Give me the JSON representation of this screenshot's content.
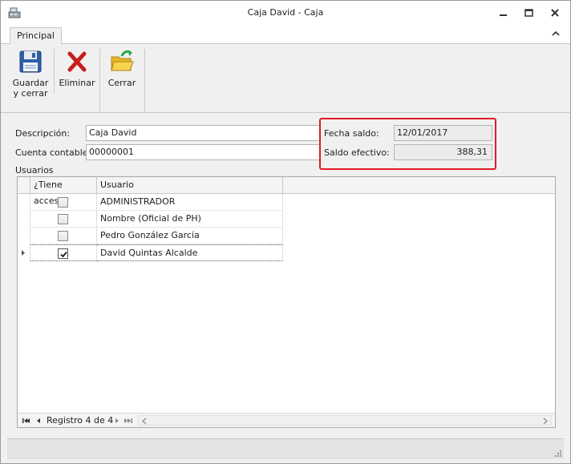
{
  "window": {
    "title": "Caja David - Caja",
    "icon": "cash-register-icon"
  },
  "ribbon": {
    "tab_principal": "Principal",
    "buttons": [
      {
        "id": "guardar",
        "label": "Guardar\ny cerrar",
        "icon": "floppy-disk-icon"
      },
      {
        "id": "eliminar",
        "label": "Eliminar",
        "icon": "red-x-icon"
      },
      {
        "id": "cerrar",
        "label": "Cerrar",
        "icon": "open-folder-icon"
      }
    ]
  },
  "form": {
    "descripcion_label": "Descripción:",
    "descripcion_value": "Caja David",
    "cuenta_label": "Cuenta contable:",
    "cuenta_value": "00000001",
    "fecha_label": "Fecha saldo:",
    "fecha_value": "12/01/2017",
    "saldo_label": "Saldo efectivo:",
    "saldo_value": "388,31",
    "usuarios_label": "Usuarios"
  },
  "grid": {
    "columns": [
      "¿Tiene acceso?",
      "Usuario"
    ],
    "rows": [
      {
        "access": false,
        "user": "ADMINISTRADOR"
      },
      {
        "access": false,
        "user": "Nombre (Oficial de PH)"
      },
      {
        "access": false,
        "user": "Pedro González García"
      },
      {
        "access": true,
        "user": "David Quintas Alcalde"
      }
    ],
    "navigator": "Registro 4 de 4"
  },
  "colors": {
    "highlight": "#e11b22",
    "accent_green": "#2fa84f"
  }
}
